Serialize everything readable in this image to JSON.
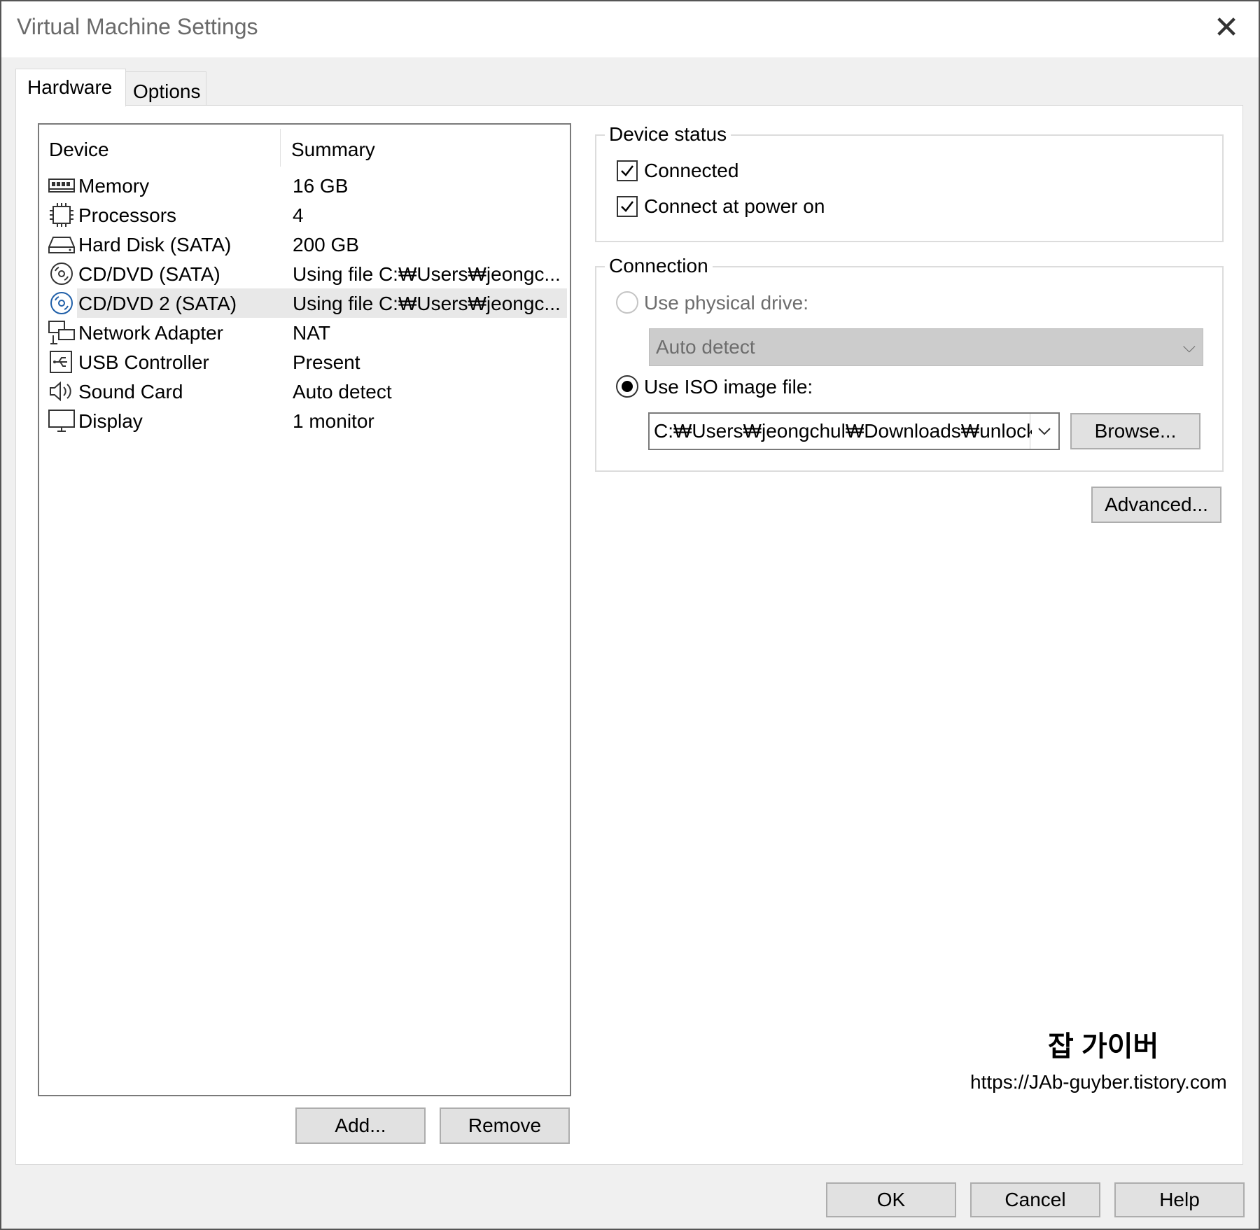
{
  "window": {
    "title": "Virtual Machine Settings"
  },
  "tabs": [
    {
      "label": "Hardware",
      "active": true
    },
    {
      "label": "Options",
      "active": false
    }
  ],
  "device_list": {
    "columns": [
      "Device",
      "Summary"
    ],
    "rows": [
      {
        "icon": "memory-icon",
        "name": "Memory",
        "summary": "16 GB"
      },
      {
        "icon": "processor-icon",
        "name": "Processors",
        "summary": "4"
      },
      {
        "icon": "hard-disk-icon",
        "name": "Hard Disk (SATA)",
        "summary": "200 GB"
      },
      {
        "icon": "cd-dvd-icon",
        "name": "CD/DVD (SATA)",
        "summary": "Using file C:₩Users₩jeongc..."
      },
      {
        "icon": "cd-dvd-icon",
        "name": "CD/DVD 2 (SATA)",
        "summary": "Using file C:₩Users₩jeongc...",
        "selected": true
      },
      {
        "icon": "network-adapter-icon",
        "name": "Network Adapter",
        "summary": "NAT"
      },
      {
        "icon": "usb-icon",
        "name": "USB Controller",
        "summary": "Present"
      },
      {
        "icon": "speaker-icon",
        "name": "Sound Card",
        "summary": "Auto detect"
      },
      {
        "icon": "display-icon",
        "name": "Display",
        "summary": "1 monitor"
      }
    ],
    "add_label": "Add...",
    "remove_label": "Remove"
  },
  "device_status": {
    "title": "Device status",
    "connected_label": "Connected",
    "connected": true,
    "power_on_label": "Connect at power on",
    "power_on": true
  },
  "connection": {
    "title": "Connection",
    "physical_label": "Use physical drive:",
    "physical_selected": false,
    "physical_value": "Auto detect",
    "iso_label": "Use ISO image file:",
    "iso_selected": true,
    "iso_path": "C:₩Users₩jeongchul₩Downloads₩unlocker",
    "browse_label": "Browse..."
  },
  "advanced_label": "Advanced...",
  "footer": {
    "ok_label": "OK",
    "cancel_label": "Cancel",
    "help_label": "Help"
  },
  "watermark": {
    "name": "잡 가이버",
    "url": "https://JAb-guyber.tistory.com"
  },
  "colors": {
    "window_bg": "#f0f0f0",
    "panel_bg": "#ffffff",
    "selection_bg": "#e8e8e8",
    "disabled_combo_bg": "#cccccc"
  }
}
